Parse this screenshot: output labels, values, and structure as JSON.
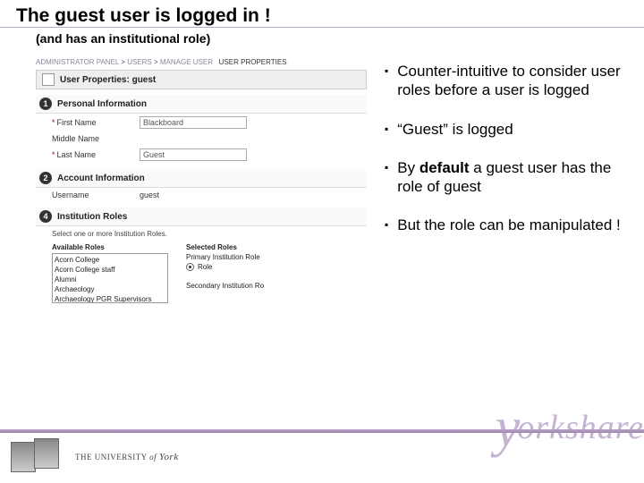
{
  "title": "The guest user is logged in !",
  "subtitle": "(and has an institutional role)",
  "screenshot": {
    "breadcrumb": {
      "a": "ADMINISTRATOR PANEL",
      "b": "USERS",
      "c": "MANAGE USER",
      "d": "USER PROPERTIES"
    },
    "panel_title": "User Properties: guest",
    "sections": {
      "s1": {
        "num": "1",
        "label": "Personal Information"
      },
      "s2": {
        "num": "2",
        "label": "Account Information"
      },
      "s4": {
        "num": "4",
        "label": "Institution Roles"
      }
    },
    "fields": {
      "first_name_label": "First Name",
      "first_name_value": "Blackboard",
      "middle_name_label": "Middle Name",
      "last_name_label": "Last Name",
      "last_name_value": "Guest",
      "username_label": "Username",
      "username_value": "guest"
    },
    "roles": {
      "instr": "Select one or more Institution Roles.",
      "available_label": "Available Roles",
      "selected_label": "Selected Roles",
      "primary_label": "Primary Institution Role",
      "secondary_label": "Secondary Institution Ro",
      "primary_value": "Role",
      "options": {
        "o1": "Acorn College",
        "o2": "Acorn College staff",
        "o3": "Alumni",
        "o4": "Archaeology",
        "o5": "Archaeology PGR Supervisors"
      }
    }
  },
  "bullets": {
    "b1": "Counter-intuitive to consider user roles before a user is logged",
    "b2": "“Guest” is logged",
    "b3_pre": "By ",
    "b3_bold": "default",
    "b3_post": " a guest user has the role of guest",
    "b4": "But the role can be manipulated !"
  },
  "footer": {
    "the": "THE",
    "uni": " UNIVERSITY ",
    "of": "of",
    "york": "York",
    "wordmark_rest": "orkshare"
  }
}
